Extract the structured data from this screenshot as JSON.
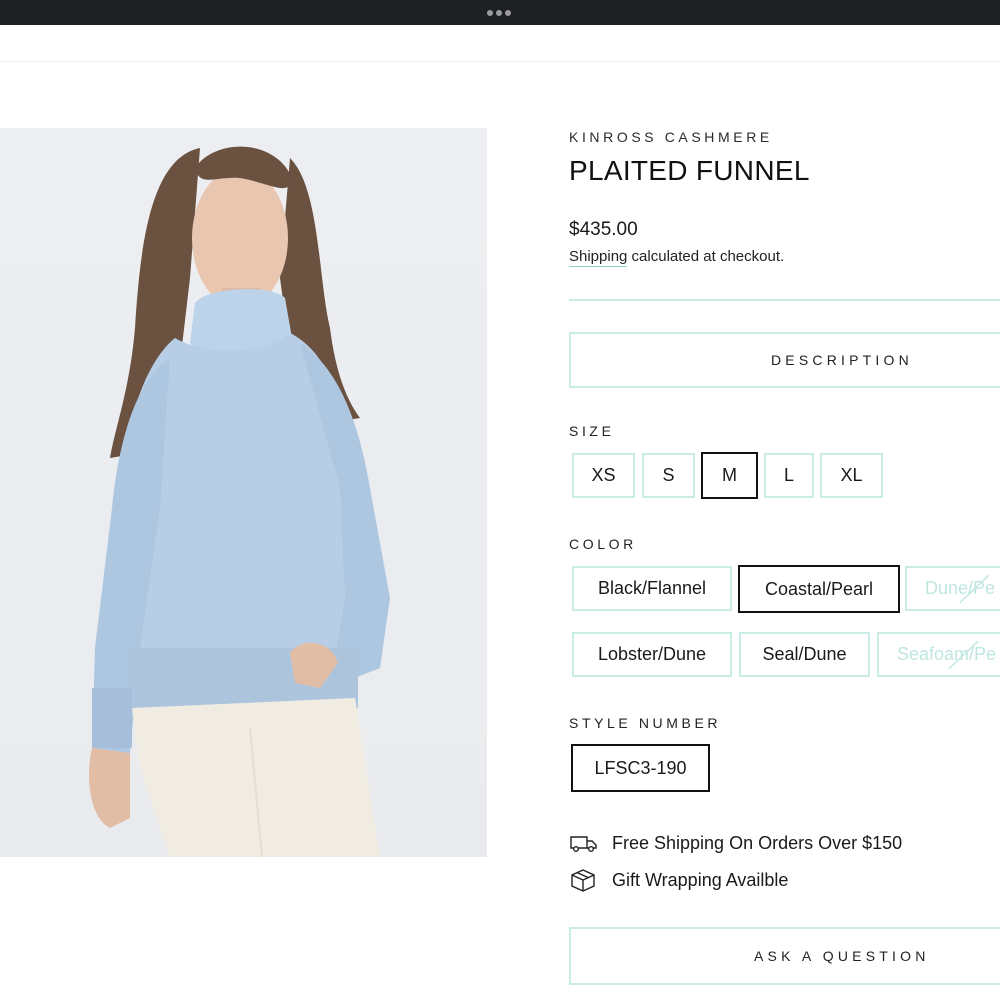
{
  "product": {
    "vendor": "KINROSS CASHMERE",
    "title": "PLAITED FUNNEL",
    "price": "$435.00",
    "shipping_link": "Shipping",
    "shipping_rest": " calculated at checkout."
  },
  "description_label": "DESCRIPTION",
  "size": {
    "label": "SIZE",
    "options": [
      "XS",
      "S",
      "M",
      "L",
      "XL"
    ],
    "selected": "M"
  },
  "color": {
    "label": "COLOR",
    "options": [
      "Black/Flannel",
      "Coastal/Pearl",
      "Dune/Pe",
      "Lobster/Dune",
      "Seal/Dune",
      "Seafoam/Pe"
    ],
    "selected": "Coastal/Pearl",
    "unavailable": [
      "Dune/Pe",
      "Seafoam/Pe"
    ]
  },
  "style_number": {
    "label": "STYLE NUMBER",
    "value": "LFSC3-190"
  },
  "features": [
    {
      "icon": "truck-icon",
      "text": "Free Shipping On Orders Over $150"
    },
    {
      "icon": "gift-box-icon",
      "text": "Gift Wrapping Availble"
    }
  ],
  "ask_label": "ASK A QUESTION",
  "colors": {
    "accent_border": "#c9ece7",
    "selected_border": "#111111",
    "topbar": "#1f2024"
  }
}
